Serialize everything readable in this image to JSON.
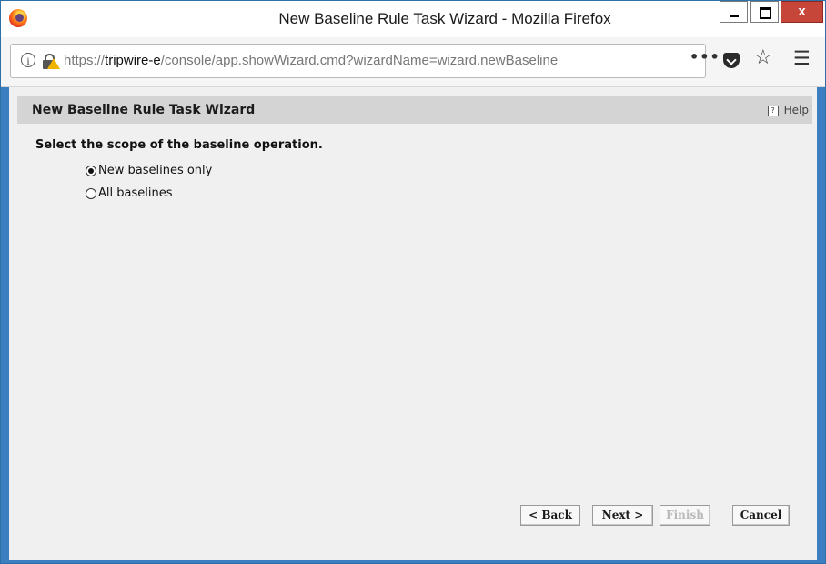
{
  "window": {
    "title": "New Baseline Rule Task Wizard - Mozilla Firefox",
    "close_label": "x"
  },
  "navbar": {
    "url_prefix": "https://",
    "url_host": "tripwire-e",
    "url_rest": "/console/app.showWizard.cmd?wizardName=wizard.newBaseline",
    "more_label": "•••",
    "icons": [
      "info-icon",
      "lock-warning-icon",
      "more-icon",
      "pocket-icon",
      "star-icon",
      "hamburger-menu-icon"
    ]
  },
  "wizard": {
    "title": "New Baseline Rule Task Wizard",
    "help_label": "Help",
    "prompt": "Select the scope of the baseline operation.",
    "options": [
      {
        "label": "New baselines only",
        "selected": true
      },
      {
        "label": "All baselines",
        "selected": false
      }
    ],
    "buttons": {
      "back": "< Back",
      "next": "Next >",
      "finish": "Finish",
      "cancel": "Cancel"
    }
  },
  "colors": {
    "header_bg": "#d4d4d4",
    "content_bg": "#f0f0f0",
    "frame": "#3b7fc0",
    "close_button": "#c7463a"
  }
}
